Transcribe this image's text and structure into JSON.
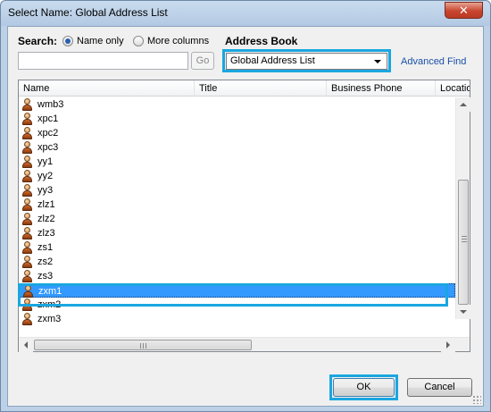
{
  "window": {
    "title": "Select Name: Global Address List",
    "close_glyph": "✕"
  },
  "search": {
    "label": "Search:",
    "option_name_only": "Name only",
    "option_more_columns": "More columns",
    "selected_option": "Name only",
    "input_value": "",
    "go_label": "Go"
  },
  "address_book": {
    "label": "Address Book",
    "selected": "Global Address List",
    "advanced_find": "Advanced Find"
  },
  "columns": [
    "Name",
    "Title",
    "Business Phone",
    "Location"
  ],
  "rows": [
    {
      "name": "wmb3",
      "selected": false
    },
    {
      "name": "xpc1",
      "selected": false
    },
    {
      "name": "xpc2",
      "selected": false
    },
    {
      "name": "xpc3",
      "selected": false
    },
    {
      "name": "yy1",
      "selected": false
    },
    {
      "name": "yy2",
      "selected": false
    },
    {
      "name": "yy3",
      "selected": false
    },
    {
      "name": "zlz1",
      "selected": false
    },
    {
      "name": "zlz2",
      "selected": false
    },
    {
      "name": "zlz3",
      "selected": false
    },
    {
      "name": "zs1",
      "selected": false
    },
    {
      "name": "zs2",
      "selected": false
    },
    {
      "name": "zs3",
      "selected": false
    },
    {
      "name": "zxm1",
      "selected": true
    },
    {
      "name": "zxm2",
      "selected": false
    },
    {
      "name": "zxm3",
      "selected": false
    }
  ],
  "buttons": {
    "ok": "OK",
    "cancel": "Cancel"
  },
  "colors": {
    "highlight": "#1aa6e0",
    "selection": "#3399ff"
  },
  "icons": {
    "contact": "person-icon"
  }
}
